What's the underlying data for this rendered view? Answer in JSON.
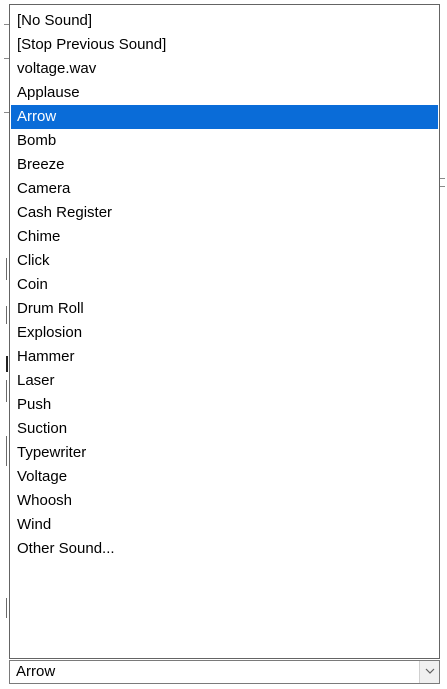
{
  "dropdown": {
    "items": [
      {
        "label": "[No Sound]",
        "selected": false
      },
      {
        "label": "[Stop Previous Sound]",
        "selected": false
      },
      {
        "label": "voltage.wav",
        "selected": false
      },
      {
        "label": "Applause",
        "selected": false
      },
      {
        "label": "Arrow",
        "selected": true
      },
      {
        "label": "Bomb",
        "selected": false
      },
      {
        "label": "Breeze",
        "selected": false
      },
      {
        "label": "Camera",
        "selected": false
      },
      {
        "label": "Cash Register",
        "selected": false
      },
      {
        "label": "Chime",
        "selected": false
      },
      {
        "label": "Click",
        "selected": false
      },
      {
        "label": "Coin",
        "selected": false
      },
      {
        "label": "Drum Roll",
        "selected": false
      },
      {
        "label": "Explosion",
        "selected": false
      },
      {
        "label": "Hammer",
        "selected": false
      },
      {
        "label": "Laser",
        "selected": false
      },
      {
        "label": "Push",
        "selected": false
      },
      {
        "label": "Suction",
        "selected": false
      },
      {
        "label": "Typewriter",
        "selected": false
      },
      {
        "label": "Voltage",
        "selected": false
      },
      {
        "label": "Whoosh",
        "selected": false
      },
      {
        "label": "Wind",
        "selected": false
      },
      {
        "label": "Other Sound...",
        "selected": false
      }
    ]
  },
  "combo": {
    "value": "Arrow",
    "button_icon": "chevron-down-icon"
  },
  "colors": {
    "selection_bg": "#0a6cd8",
    "selection_text": "#ffffff",
    "border": "#646464"
  }
}
